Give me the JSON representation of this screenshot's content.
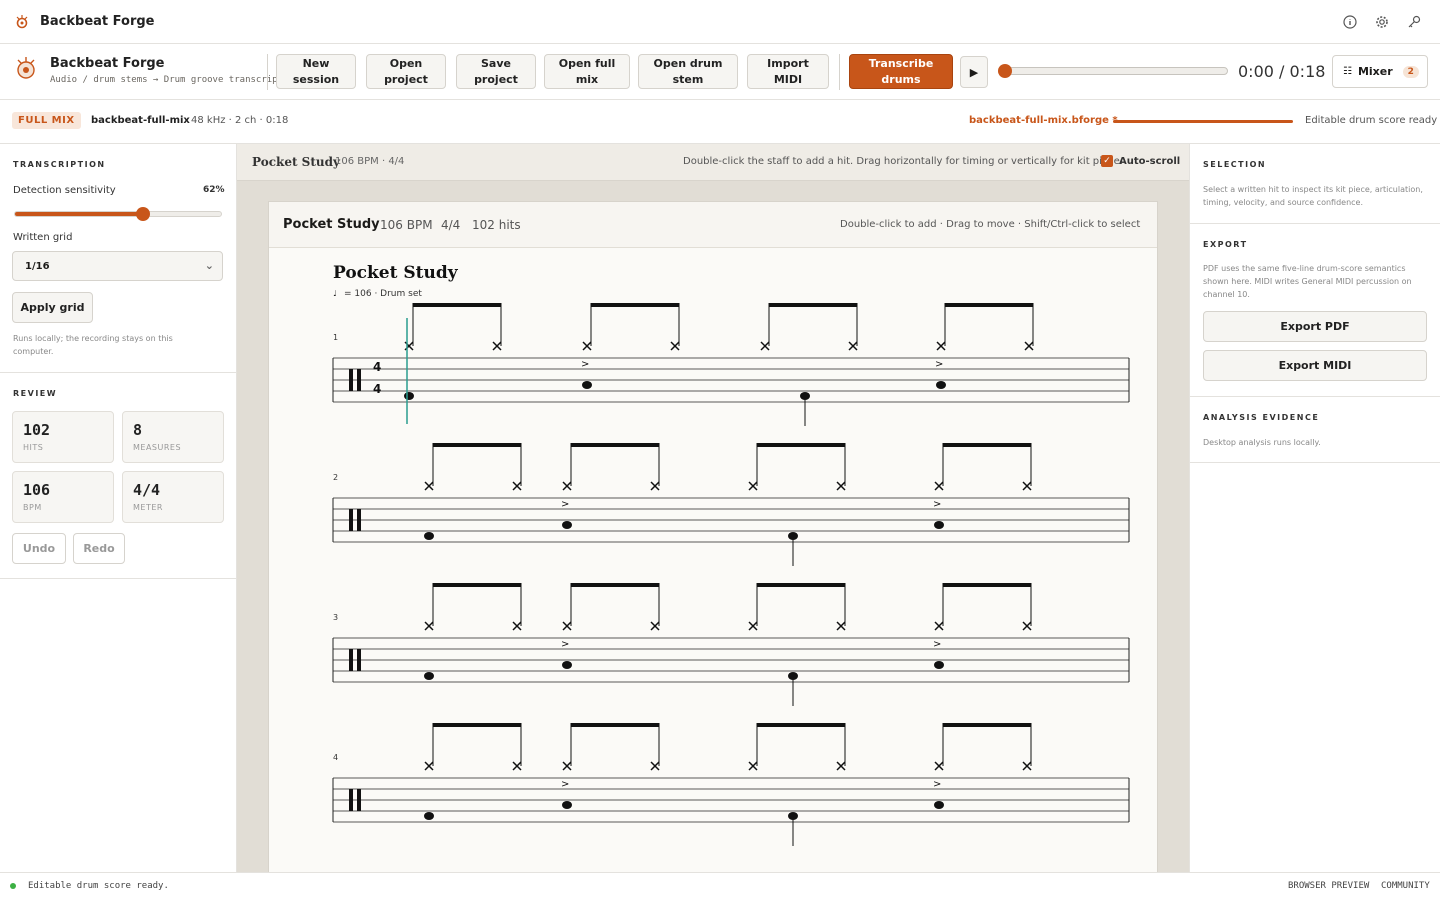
{
  "app": {
    "title": "Backbeat Forge"
  },
  "toolbar": {
    "brand_name": "Backbeat Forge",
    "brand_sub": "Audio / drum stems → Drum groove transcription",
    "buttons": [
      {
        "line1": "New",
        "line2": "session"
      },
      {
        "line1": "Open",
        "line2": "project"
      },
      {
        "line1": "Save",
        "line2": "project"
      },
      {
        "line1": "Open full",
        "line2": "mix"
      },
      {
        "line1": "Open drum",
        "line2": "stem"
      },
      {
        "line1": "Import",
        "line2": "MIDI"
      }
    ],
    "transcribe": {
      "line1": "Transcribe",
      "line2": "drums"
    },
    "play_glyph": "▶",
    "progress": 0.0,
    "time": "0:00 / 0:18",
    "mixer_label": "Mixer",
    "mixer_count": "2"
  },
  "source": {
    "tag": "FULL MIX",
    "name": "backbeat-full-mix",
    "meta": "48 kHz · 2 ch · 0:18",
    "project_file": "backbeat-full-mix.bforge *",
    "status": "Editable drum score ready"
  },
  "transcription": {
    "heading": "TRANSCRIPTION",
    "sensitivity_label": "Detection sensitivity",
    "sensitivity_value": "62%",
    "sensitivity": 0.62,
    "grid_label": "Written grid",
    "grid_value": "1/16",
    "apply_label": "Apply grid",
    "note": "Runs locally; the recording stays on this computer."
  },
  "review": {
    "heading": "REVIEW",
    "stats": [
      {
        "value": "102",
        "label": "HITS"
      },
      {
        "value": "8",
        "label": "MEASURES"
      },
      {
        "value": "106",
        "label": "BPM"
      },
      {
        "value": "4/4",
        "label": "METER"
      }
    ],
    "undo": "Undo",
    "redo": "Redo"
  },
  "center": {
    "title": "Pocket Study",
    "meta": "106 BPM · 4/4",
    "hint": "Double-click the staff to add a hit. Drag horizontally for timing or vertically for kit piece.",
    "autoscroll": "Auto-scroll",
    "autoscroll_checked": true
  },
  "paper": {
    "title": "Pocket Study",
    "bpm": "106 BPM",
    "meter": "4/4",
    "hits": "102 hits",
    "hint": "Double-click to add · Drag to move · Shift/Ctrl-click to select",
    "score_title": "Pocket Study",
    "tempo_line": "= 106 · Drum set",
    "time_sig_top": "4",
    "time_sig_bottom": "4",
    "measure_numbers": [
      "1",
      "2",
      "3",
      "4"
    ]
  },
  "selection": {
    "heading": "SELECTION",
    "text": "Select a written hit to inspect its kit piece, articulation, timing, velocity, and source confidence."
  },
  "export": {
    "heading": "EXPORT",
    "text": "PDF uses the same five-line drum-score semantics shown here. MIDI writes General MIDI percussion on channel 10.",
    "pdf": "Export PDF",
    "midi": "Export MIDI"
  },
  "analysis": {
    "heading": "ANALYSIS EVIDENCE",
    "text": "Desktop analysis runs locally."
  },
  "statusbar": {
    "status": "Editable drum score ready.",
    "right1": "BROWSER PREVIEW",
    "right2": "COMMUNITY"
  },
  "colors": {
    "accent": "#c8561a",
    "playhead": "#2a9d8f",
    "ok": "#3cb043"
  }
}
